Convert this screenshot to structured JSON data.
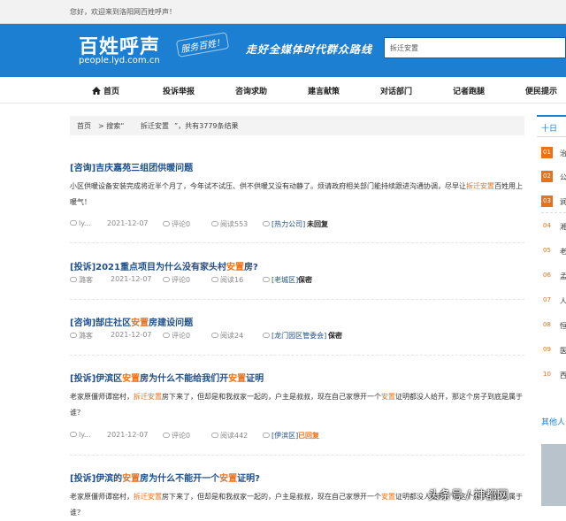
{
  "topbar": {
    "greeting": "您好，欢迎来到洛阳网百姓呼声！"
  },
  "banner": {
    "logo": "百姓呼声",
    "logo_sub": "服务百姓！",
    "url": "people.lyd.com.cn",
    "slogan": "走好全媒体时代群众路线",
    "search_value": "拆迁安置"
  },
  "nav": [
    "首页",
    "投诉举报",
    "咨询求助",
    "建言献策",
    "对话部门",
    "记者跑腿",
    "便民提示"
  ],
  "breadcrumb": {
    "home": "首页",
    "prefix": "> 搜索“",
    "keyword": "拆迁安置",
    "suffix": "”，共有3779条结果"
  },
  "articles": [
    {
      "title_a": "[咨询]吉庆嘉苑三组团供暖问题",
      "title_hl": "",
      "title_b": "",
      "body": [
        "小区供暖设备安装完成将近半个月了，今年试不试压、供不供暖又没有动静了。烦请政府相关部门能持续跟进沟通协调，尽早让",
        "拆迁安置",
        "百姓用上暖气！"
      ],
      "author": "ly...",
      "date": "2021-12-07",
      "comments": "评论0",
      "reads": "阅读553",
      "category": "[热力公司]",
      "status": "未回复"
    },
    {
      "title_a": "[投诉]2021重点项目为什么没有家头村",
      "title_hl": "安置",
      "title_b": "房?",
      "author": "潞客",
      "date": "2021-12-07",
      "comments": "评论0",
      "reads": "阅读16",
      "category": "[老城区]",
      "status": "保密"
    },
    {
      "title_a": "[咨询]郜庄社区",
      "title_hl": "安置",
      "title_b": "房建设问题",
      "author": "潞客",
      "date": "2021-12-07",
      "comments": "评论0",
      "reads": "阅读24",
      "category": "[龙门园区管委会]",
      "status": "保密"
    },
    {
      "title_a": "[投诉]伊滨区",
      "title_hl": "安置",
      "title_b": "房为什么不能给我们开",
      "title_hl2": "安置",
      "title_c": "证明",
      "body": [
        "老家原僵师谭窑村，",
        "拆迁安置",
        "房下来了，但却是和我叔家一起的，户主是叔叔，现在自己家想开一个",
        "安置",
        "证明都没人给开，那这个房子到底是属于谁？"
      ],
      "author": "ly...",
      "date": "2021-12-07",
      "comments": "评论0",
      "reads": "阅读442",
      "category": "[伊滨区]",
      "status": "已回复"
    },
    {
      "title_a": "[投诉]伊滨的",
      "title_hl": "安置",
      "title_b": "房为什么不能开一个",
      "title_hl2": "安置",
      "title_c": "证明?",
      "body": [
        "老家原僵师谭窑村，",
        "拆迁安置",
        "房下来了，但却是和我叔家一起的，户主是叔叔，现在自己家想开一个",
        "安置",
        "证明都没人给开，那这个房子到底是属于谁？"
      ]
    }
  ],
  "sidebar": {
    "heading": "十日",
    "items": [
      {
        "num": "01",
        "text": "治"
      },
      {
        "num": "02",
        "text": "公"
      },
      {
        "num": "03",
        "text": "涧"
      },
      {
        "num": "04",
        "text": "湘"
      },
      {
        "num": "05",
        "text": "老"
      },
      {
        "num": "06",
        "text": "孟"
      },
      {
        "num": "07",
        "text": "人"
      },
      {
        "num": "08",
        "text": "恒"
      },
      {
        "num": "09",
        "text": "医"
      },
      {
        "num": "10",
        "text": "西"
      }
    ],
    "heading2": "其他人"
  },
  "watermark": "头条号 / 神都网"
}
